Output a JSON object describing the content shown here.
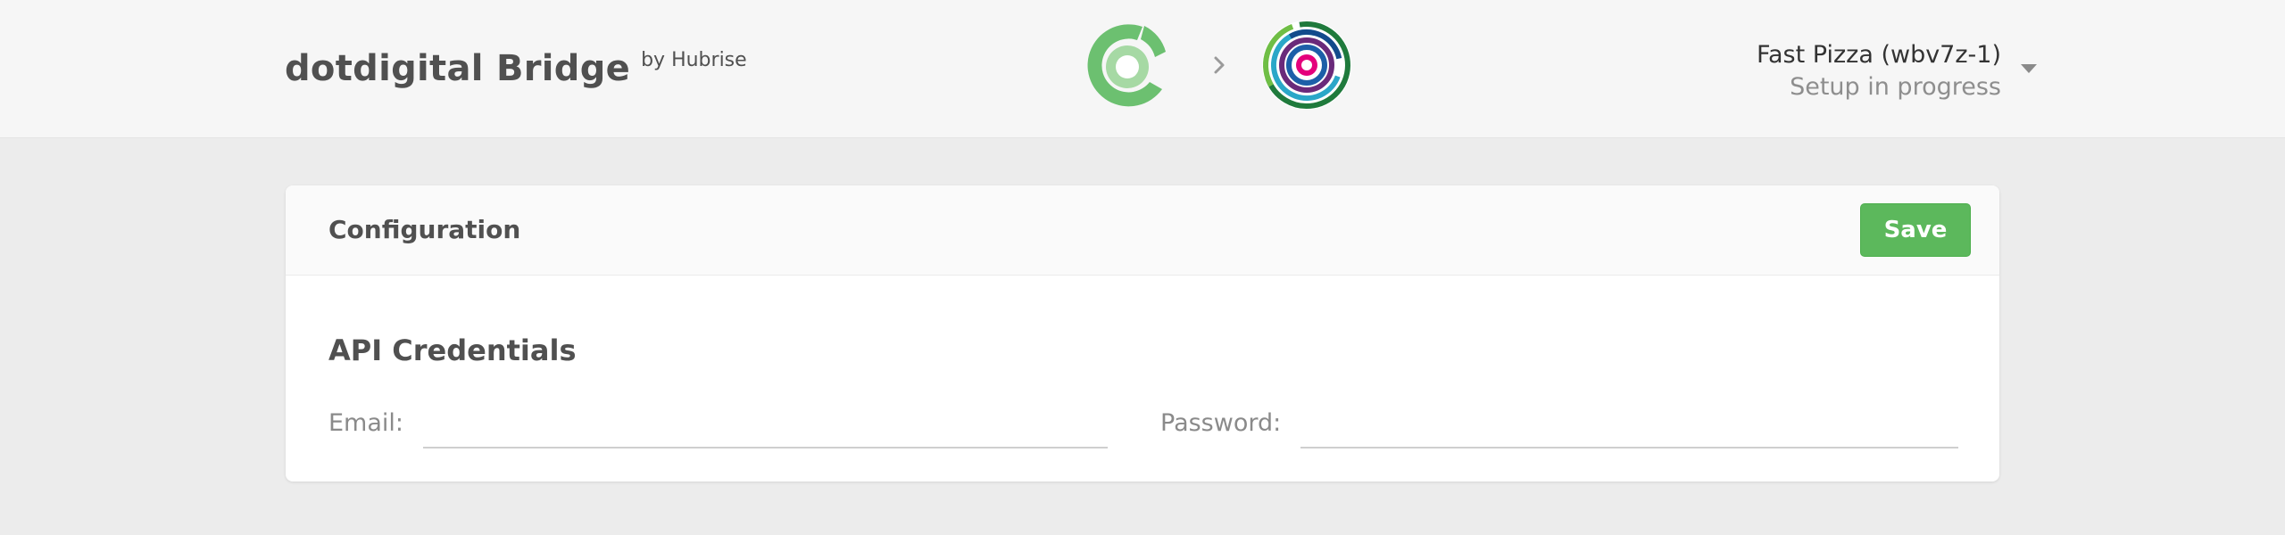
{
  "header": {
    "brand_name": "dotdigital Bridge",
    "brand_by": "by Hubrise",
    "logos": {
      "left": "hubrise-logo-icon",
      "separator": "chevron-right-icon",
      "right": "dotdigital-logo-icon"
    },
    "account": {
      "name": "Fast Pizza (wbv7z-1)",
      "status": "Setup in progress",
      "menu_icon": "caret-down-icon"
    }
  },
  "card": {
    "title": "Configuration",
    "save_label": "Save",
    "section_title": "API Credentials",
    "fields": {
      "email_label": "Email:",
      "email_value": "",
      "password_label": "Password:",
      "password_value": ""
    }
  },
  "colors": {
    "header_bg": "#f6f6f6",
    "page_bg": "#ececec",
    "save_button": "#5cb85c",
    "hubrise_green_dark": "#6cc070",
    "hubrise_green_light": "#a6d9a4"
  }
}
